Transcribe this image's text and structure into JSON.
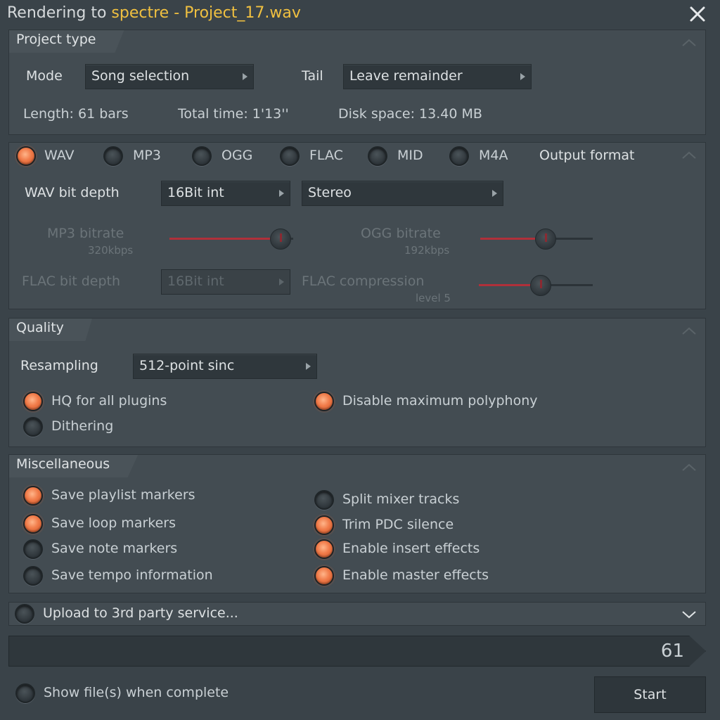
{
  "window": {
    "title_prefix": "Rendering to ",
    "title_project": "spectre - Project_17.wav"
  },
  "project_type": {
    "header": "Project type",
    "mode_label": "Mode",
    "mode_value": "Song selection",
    "tail_label": "Tail",
    "tail_value": "Leave remainder",
    "length": "Length: 61 bars",
    "total_time": "Total time: 1'13''",
    "disk_space": "Disk space: 13.40 MB"
  },
  "output_format": {
    "header": "Output format",
    "formats": [
      {
        "label": "WAV",
        "selected": true
      },
      {
        "label": "MP3",
        "selected": false
      },
      {
        "label": "OGG",
        "selected": false
      },
      {
        "label": "FLAC",
        "selected": false
      },
      {
        "label": "MID",
        "selected": false
      },
      {
        "label": "M4A",
        "selected": false
      }
    ],
    "wav_bit_depth_label": "WAV bit depth",
    "wav_bit_depth_value": "16Bit int",
    "channels_value": "Stereo",
    "mp3_bitrate_label": "MP3 bitrate",
    "mp3_bitrate_value": "320kbps",
    "mp3_bitrate_level": 0.98,
    "ogg_bitrate_label": "OGG bitrate",
    "ogg_bitrate_value": "192kbps",
    "ogg_bitrate_level": 0.6,
    "flac_bit_depth_label": "FLAC bit depth",
    "flac_bit_depth_value": "16Bit int",
    "flac_compression_label": "FLAC compression",
    "flac_compression_value": "level 5",
    "flac_compression_level": 0.55
  },
  "quality": {
    "header": "Quality",
    "resampling_label": "Resampling",
    "resampling_value": "512-point sinc",
    "options": [
      {
        "label": "HQ for all plugins",
        "checked": true
      },
      {
        "label": "Disable maximum polyphony",
        "checked": true
      },
      {
        "label": "Dithering",
        "checked": false
      }
    ]
  },
  "misc": {
    "header": "Miscellaneous",
    "options": [
      {
        "label": "Save playlist markers",
        "checked": true
      },
      {
        "label": "Save loop markers",
        "checked": true
      },
      {
        "label": "Save note markers",
        "checked": false
      },
      {
        "label": "Save tempo information",
        "checked": false
      },
      {
        "label": "Split mixer tracks",
        "checked": false
      },
      {
        "label": "Trim PDC silence",
        "checked": true
      },
      {
        "label": "Enable insert effects",
        "checked": true
      },
      {
        "label": "Enable master effects",
        "checked": true
      }
    ]
  },
  "upload": {
    "label": "Upload to 3rd party service...",
    "checked": false
  },
  "progress": {
    "value": "61"
  },
  "footer": {
    "show_files_label": "Show file(s) when complete",
    "show_files_checked": false,
    "start_label": "Start"
  },
  "colors": {
    "accent": "#f07a48",
    "title_highlight": "#f0c040",
    "background": "#3a4349"
  }
}
